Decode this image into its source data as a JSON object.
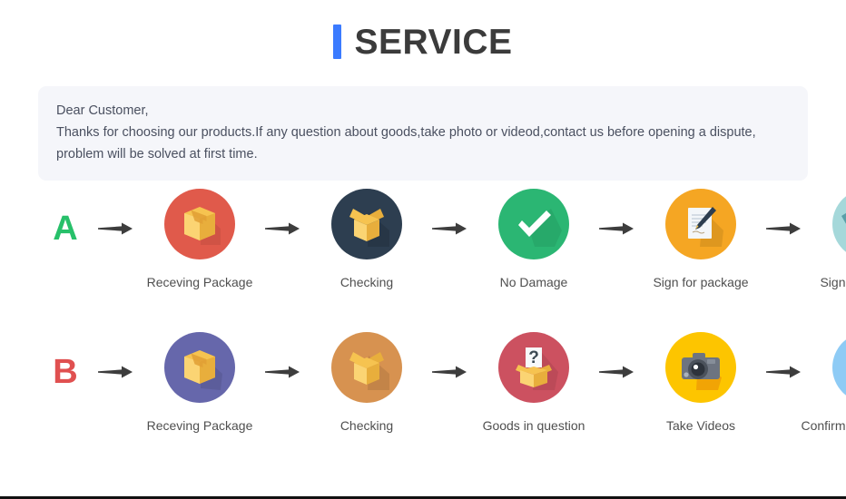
{
  "header": {
    "title": "SERVICE",
    "accent_color": "#3b7bff"
  },
  "notice": {
    "line1": "Dear Customer,",
    "line2": "Thanks for choosing our products.If any question about goods,take photo or videod,contact us before opening a dispute,",
    "line3": "problem will be solved at first time.",
    "background_color": "#f5f6fa",
    "text_color": "#4a5060"
  },
  "flows": [
    {
      "letter": "A",
      "letter_color": "#27c06a",
      "steps": [
        {
          "label": "Receving Package",
          "icon": "closed-box-icon",
          "circle_color": "#e05a4b"
        },
        {
          "label": "Checking",
          "icon": "open-box-icon",
          "circle_color": "#2d3e50"
        },
        {
          "label": "No Damage",
          "icon": "checkmark-icon",
          "circle_color": "#2bb673"
        },
        {
          "label": "Sign for package",
          "icon": "sign-document-icon",
          "circle_color": "#f5a623"
        },
        {
          "label": "Sign for package",
          "icon": "handshake-icon",
          "circle_color": "#a5d8da"
        }
      ]
    },
    {
      "letter": "B",
      "letter_color": "#e05050",
      "steps": [
        {
          "label": "Receving Package",
          "icon": "closed-box-icon",
          "circle_color": "#6667ab"
        },
        {
          "label": "Checking",
          "icon": "open-box-icon",
          "circle_color": "#d79250"
        },
        {
          "label": "Goods in question",
          "icon": "question-box-icon",
          "circle_color": "#cc5160"
        },
        {
          "label": "Take Videos",
          "icon": "camera-icon",
          "circle_color": "#fdc500"
        },
        {
          "label": "Confirm problem,refund money",
          "icon": "support-person-icon",
          "circle_color": "#8ecbf5"
        }
      ]
    }
  ],
  "arrow": {
    "color": "#3d3d3d",
    "name": "right-arrow-icon"
  }
}
